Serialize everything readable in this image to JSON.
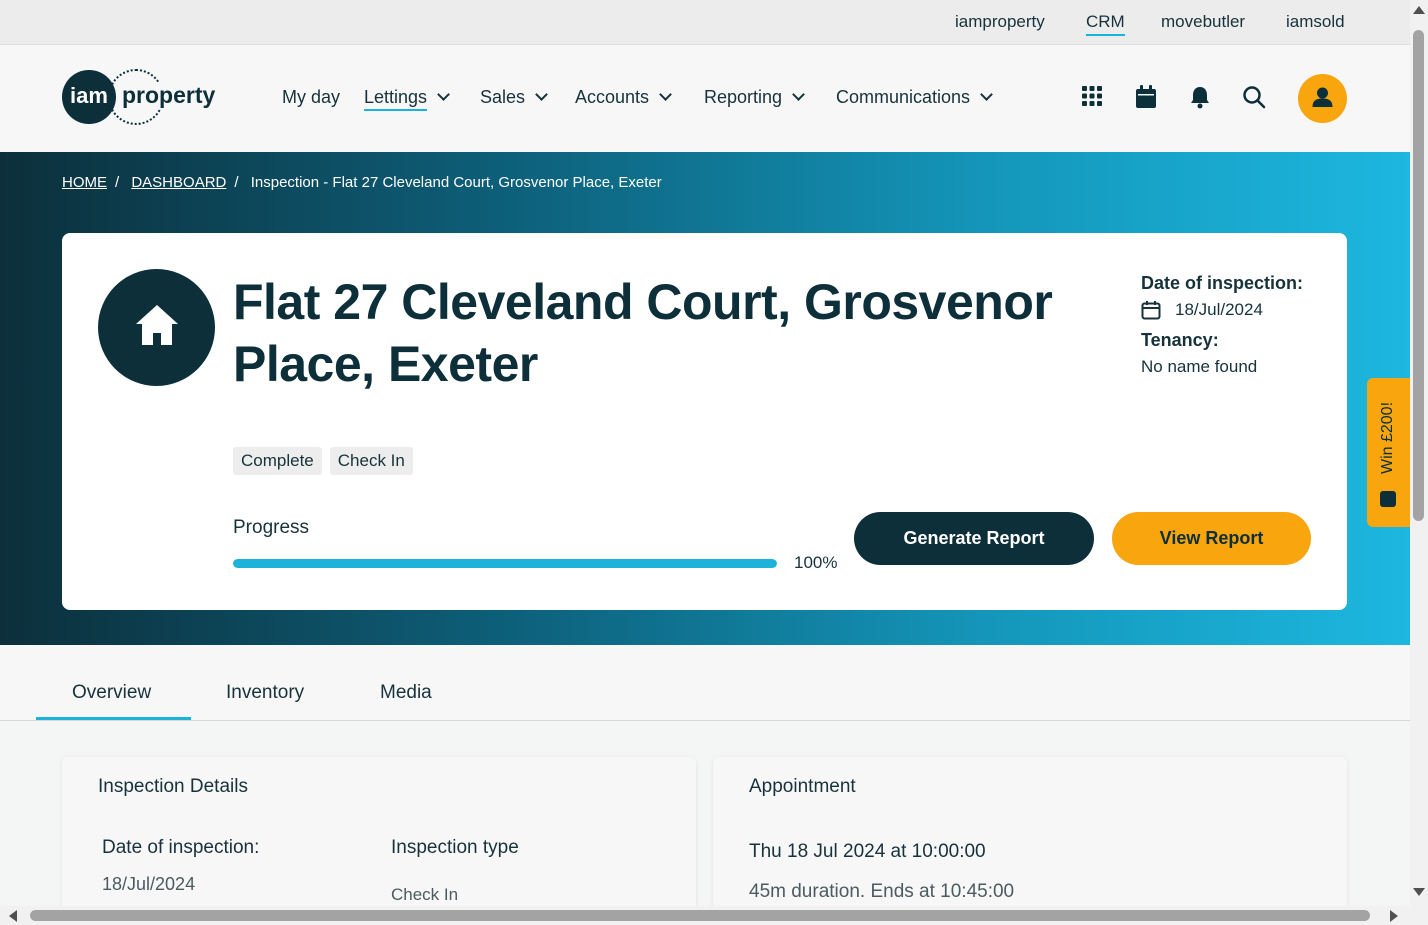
{
  "topbar": {
    "links": [
      "iamproperty",
      "CRM",
      "movebutler",
      "iamsold"
    ],
    "active": "CRM"
  },
  "header": {
    "logo_short": "iam",
    "logo_text": "property",
    "nav": [
      {
        "label": "My day",
        "dropdown": false
      },
      {
        "label": "Lettings",
        "dropdown": true,
        "active": true
      },
      {
        "label": "Sales",
        "dropdown": true
      },
      {
        "label": "Accounts",
        "dropdown": true
      },
      {
        "label": "Reporting",
        "dropdown": true
      },
      {
        "label": "Communications",
        "dropdown": true
      }
    ],
    "icons": [
      "apps-grid-icon",
      "calendar-icon",
      "bell-icon",
      "search-icon",
      "user-icon"
    ]
  },
  "breadcrumb": {
    "home": "HOME",
    "dashboard": "DASHBOARD",
    "current": "Inspection - Flat 27 Cleveland Court, Grosvenor Place, Exeter",
    "sep": "/"
  },
  "property": {
    "title": "Flat 27 Cleveland Court, Grosvenor Place, Exeter",
    "date_label": "Date of inspection:",
    "date_value": "18/Jul/2024",
    "tenancy_label": "Tenancy:",
    "tenancy_value": "No name found",
    "tags": [
      "Complete",
      "Check In"
    ],
    "progress_label": "Progress",
    "progress_value": 1.0,
    "progress_text": "100%",
    "generate_button": "Generate Report",
    "view_button": "View Report"
  },
  "side_widget": {
    "label": "Win £200!"
  },
  "tabs": {
    "items": [
      "Overview",
      "Inventory",
      "Media"
    ],
    "active": "Overview"
  },
  "inspection_details": {
    "title": "Inspection Details",
    "date_label": "Date of inspection:",
    "date_value": "18/Jul/2024",
    "type_label": "Inspection type",
    "type_value": "Check In"
  },
  "appointment": {
    "title": "Appointment",
    "datetime": "Thu 18 Jul 2024 at 10:00:00",
    "duration": "45m duration. Ends at 10:45:00"
  },
  "colors": {
    "brand_dark": "#0d2f3a",
    "accent_blue": "#1bb3d9",
    "accent_gold": "#f9a50d"
  }
}
